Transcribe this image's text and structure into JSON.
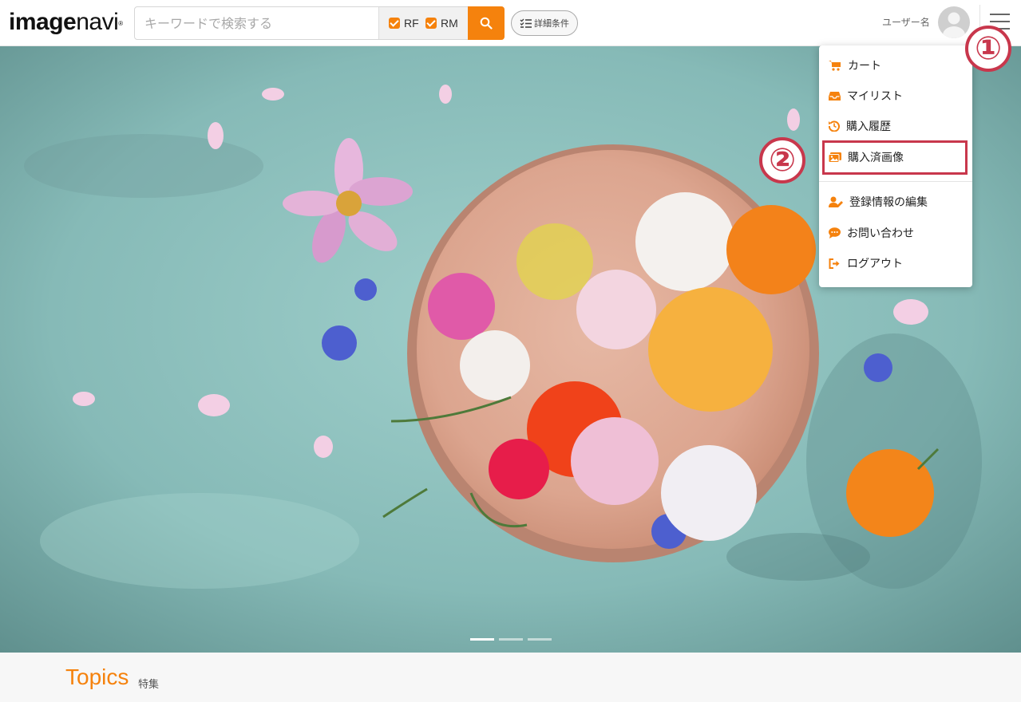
{
  "header": {
    "logo": {
      "bold": "image",
      "light": "navi",
      "mark": "®"
    },
    "search": {
      "placeholder": "キーワードで検索する",
      "filters": [
        {
          "label": "RF",
          "checked": true
        },
        {
          "label": "RM",
          "checked": true
        }
      ],
      "button_icon": "search-icon"
    },
    "detail_button": {
      "label": "詳細条件",
      "icon": "checklist-icon"
    },
    "user": {
      "name": "ユーザー名",
      "avatar_icon": "user-avatar-icon"
    },
    "menu_icon": "hamburger-icon"
  },
  "hero": {
    "slides_total": 3,
    "active_slide": 1
  },
  "topics": {
    "title": "Topics",
    "subtitle": "特集"
  },
  "user_menu": {
    "items": [
      {
        "label": "カート",
        "icon": "cart-icon"
      },
      {
        "label": "マイリスト",
        "icon": "inbox-icon"
      },
      {
        "label": "購入履歴",
        "icon": "history-icon"
      },
      {
        "label": "購入済画像",
        "icon": "images-icon"
      },
      {
        "label": "登録情報の編集",
        "icon": "user-edit-icon"
      },
      {
        "label": "お問い合わせ",
        "icon": "chat-icon"
      },
      {
        "label": "ログアウト",
        "icon": "logout-icon"
      }
    ],
    "highlighted_item": "購入済画像"
  },
  "annotations": [
    {
      "label": "①"
    },
    {
      "label": "②"
    }
  ],
  "colors": {
    "accent": "#f5820d",
    "annotation": "#c8374c",
    "hero_background": "#8dbfbd",
    "topics_background": "#f7f7f7"
  }
}
